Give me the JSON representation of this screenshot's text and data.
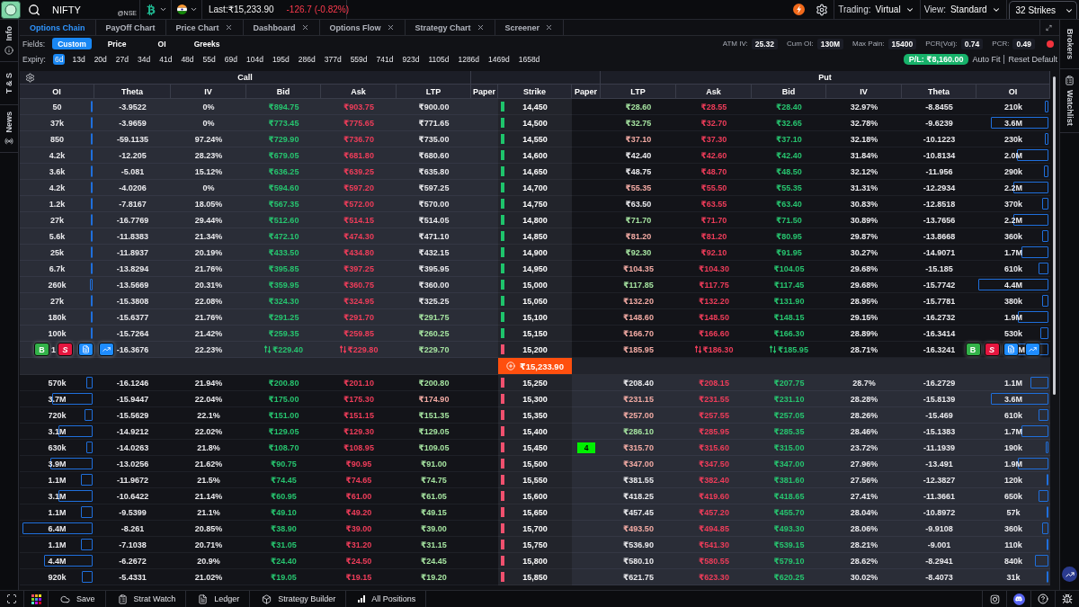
{
  "top_bar": {
    "symbol": "NIFTY",
    "exchange": "@NSE",
    "last": "Last:₹15,233.90",
    "change": "-126.7 (-0.82%)",
    "selectors": [
      {
        "label": "Trading:",
        "value": "Virtual"
      },
      {
        "label": "View:",
        "value": "Standard"
      }
    ],
    "strikes": "32 Strikes"
  },
  "left_sidebar": [
    {
      "label": "Info",
      "kind": "info"
    },
    {
      "label": "T & S",
      "kind": "text"
    },
    {
      "label": "News",
      "kind": "news"
    }
  ],
  "right_sidebar": [
    {
      "label": "Brokers",
      "kind": "text"
    },
    {
      "label": "Watchlist",
      "kind": "watchlist"
    }
  ],
  "tabs": [
    {
      "label": "Options Chain",
      "selected": true,
      "closable": false
    },
    {
      "label": "PayOff Chart",
      "selected": false,
      "closable": false
    },
    {
      "label": "Price Chart",
      "selected": false,
      "closable": true
    },
    {
      "label": "Dashboard",
      "selected": false,
      "closable": true
    },
    {
      "label": "Options Flow",
      "selected": false,
      "closable": true
    },
    {
      "label": "Strategy Chart",
      "selected": false,
      "closable": true
    },
    {
      "label": "Screener",
      "selected": false,
      "closable": true
    }
  ],
  "fields": {
    "label": "Fields:",
    "options": [
      {
        "label": "Custom",
        "selected": true
      },
      {
        "label": "Price",
        "selected": false
      },
      {
        "label": "OI",
        "selected": false
      },
      {
        "label": "Greeks",
        "selected": false
      }
    ]
  },
  "stats": [
    {
      "label": "ATM IV:",
      "value": "25.32"
    },
    {
      "label": "Cum OI:",
      "value": "130M"
    },
    {
      "label": "Max Pain:",
      "value": "15400"
    },
    {
      "label": "PCR(Vol):",
      "value": "0.74"
    },
    {
      "label": "PCR:",
      "value": "0.49"
    }
  ],
  "expiry": {
    "label": "Expiry:",
    "options": [
      {
        "label": "6d",
        "selected": true
      },
      {
        "label": "13d",
        "selected": false
      },
      {
        "label": "20d",
        "selected": false
      },
      {
        "label": "27d",
        "selected": false
      },
      {
        "label": "34d",
        "selected": false
      },
      {
        "label": "41d",
        "selected": false
      },
      {
        "label": "48d",
        "selected": false
      },
      {
        "label": "55d",
        "selected": false
      },
      {
        "label": "69d",
        "selected": false
      },
      {
        "label": "104d",
        "selected": false
      },
      {
        "label": "195d",
        "selected": false
      },
      {
        "label": "286d",
        "selected": false
      },
      {
        "label": "377d",
        "selected": false
      },
      {
        "label": "559d",
        "selected": false
      },
      {
        "label": "741d",
        "selected": false
      },
      {
        "label": "923d",
        "selected": false
      },
      {
        "label": "1105d",
        "selected": false
      },
      {
        "label": "1286d",
        "selected": false
      },
      {
        "label": "1469d",
        "selected": false
      },
      {
        "label": "1658d",
        "selected": false
      }
    ]
  },
  "pnl": "P/L: ₹8,160.00",
  "links": [
    "Auto Fit",
    "Reset Default"
  ],
  "table": {
    "groups": [
      "Call",
      "Put"
    ],
    "columns": [
      "OI",
      "Theta",
      "IV",
      "Bid",
      "Ask",
      "LTP",
      "Paper",
      "Strike",
      "Paper",
      "LTP",
      "Ask",
      "Bid",
      "IV",
      "Theta",
      "OI"
    ],
    "rows": [
      {
        "kind": "strike",
        "strike": "14,450",
        "color": "#1ec46b",
        "hovered": false,
        "call": {
          "itm": true,
          "oi": "50",
          "level": 0.02,
          "theta": "-3.9522",
          "iv": "0%",
          "bid": "₹894.75",
          "ask": "₹903.75",
          "ltp": "₹900.00",
          "up": false,
          "down": false
        },
        "put": {
          "itm": false,
          "ltp": "₹28.60",
          "up": true,
          "down": false,
          "ask": "₹28.55",
          "bid": "₹28.40",
          "iv": "32.97%",
          "theta": "-8.8455",
          "oi": "210k",
          "level": 0.05
        }
      },
      {
        "kind": "strike",
        "strike": "14,500",
        "color": "#1ec46b",
        "hovered": false,
        "call": {
          "itm": true,
          "oi": "37k",
          "level": 0.02,
          "theta": "-3.9659",
          "iv": "0%",
          "bid": "₹773.45",
          "ask": "₹775.65",
          "ltp": "₹771.65",
          "up": false,
          "down": false
        },
        "put": {
          "itm": false,
          "ltp": "₹32.75",
          "up": true,
          "down": false,
          "ask": "₹32.70",
          "bid": "₹32.65",
          "iv": "32.78%",
          "theta": "-9.6239",
          "oi": "3.6M",
          "level": 0.78
        }
      },
      {
        "kind": "strike",
        "strike": "14,550",
        "color": "#1ec46b",
        "hovered": false,
        "call": {
          "itm": true,
          "oi": "850",
          "level": 0.02,
          "theta": "-59.1135",
          "iv": "97.24%",
          "bid": "₹729.90",
          "ask": "₹736.70",
          "ltp": "₹735.00",
          "up": false,
          "down": false
        },
        "put": {
          "itm": false,
          "ltp": "₹37.10",
          "up": false,
          "down": true,
          "ask": "₹37.30",
          "bid": "₹37.10",
          "iv": "32.18%",
          "theta": "-10.1223",
          "oi": "230k",
          "level": 0.05
        }
      },
      {
        "kind": "strike",
        "strike": "14,600",
        "color": "#1ec46b",
        "hovered": false,
        "call": {
          "itm": true,
          "oi": "4.2k",
          "level": 0.02,
          "theta": "-12.205",
          "iv": "28.23%",
          "bid": "₹679.05",
          "ask": "₹681.80",
          "ltp": "₹680.60",
          "up": false,
          "down": false
        },
        "put": {
          "itm": false,
          "ltp": "₹42.40",
          "up": false,
          "down": false,
          "ask": "₹42.60",
          "bid": "₹42.40",
          "iv": "31.84%",
          "theta": "-10.8134",
          "oi": "2.0M",
          "level": 0.43
        }
      },
      {
        "kind": "strike",
        "strike": "14,650",
        "color": "#1ec46b",
        "hovered": false,
        "call": {
          "itm": true,
          "oi": "3.6k",
          "level": 0.02,
          "theta": "-5.081",
          "iv": "15.12%",
          "bid": "₹636.25",
          "ask": "₹639.25",
          "ltp": "₹635.80",
          "up": false,
          "down": false
        },
        "put": {
          "itm": false,
          "ltp": "₹48.75",
          "up": false,
          "down": false,
          "ask": "₹48.70",
          "bid": "₹48.50",
          "iv": "32.12%",
          "theta": "-11.956",
          "oi": "290k",
          "level": 0.06
        }
      },
      {
        "kind": "strike",
        "strike": "14,700",
        "color": "#1ec46b",
        "hovered": false,
        "call": {
          "itm": true,
          "oi": "4.2k",
          "level": 0.02,
          "theta": "-4.0206",
          "iv": "0%",
          "bid": "₹594.60",
          "ask": "₹597.20",
          "ltp": "₹597.25",
          "up": false,
          "down": false
        },
        "put": {
          "itm": false,
          "ltp": "₹55.35",
          "up": false,
          "down": true,
          "ask": "₹55.50",
          "bid": "₹55.35",
          "iv": "31.31%",
          "theta": "-12.2934",
          "oi": "2.2M",
          "level": 0.47
        }
      },
      {
        "kind": "strike",
        "strike": "14,750",
        "color": "#1ec46b",
        "hovered": false,
        "call": {
          "itm": true,
          "oi": "1.2k",
          "level": 0.02,
          "theta": "-7.8167",
          "iv": "18.05%",
          "bid": "₹567.35",
          "ask": "₹572.00",
          "ltp": "₹570.00",
          "up": false,
          "down": false
        },
        "put": {
          "itm": false,
          "ltp": "₹63.50",
          "up": false,
          "down": false,
          "ask": "₹63.55",
          "bid": "₹63.40",
          "iv": "30.83%",
          "theta": "-12.8518",
          "oi": "370k",
          "level": 0.08
        }
      },
      {
        "kind": "strike",
        "strike": "14,800",
        "color": "#1ec46b",
        "hovered": false,
        "call": {
          "itm": true,
          "oi": "27k",
          "level": 0.02,
          "theta": "-16.7769",
          "iv": "29.44%",
          "bid": "₹512.60",
          "ask": "₹514.15",
          "ltp": "₹514.05",
          "up": false,
          "down": false
        },
        "put": {
          "itm": false,
          "ltp": "₹71.70",
          "up": true,
          "down": false,
          "ask": "₹71.70",
          "bid": "₹71.50",
          "iv": "30.89%",
          "theta": "-13.7656",
          "oi": "2.2M",
          "level": 0.47
        }
      },
      {
        "kind": "strike",
        "strike": "14,850",
        "color": "#1ec46b",
        "hovered": false,
        "call": {
          "itm": true,
          "oi": "5.6k",
          "level": 0.02,
          "theta": "-11.8383",
          "iv": "21.34%",
          "bid": "₹472.10",
          "ask": "₹474.30",
          "ltp": "₹471.10",
          "up": false,
          "down": false
        },
        "put": {
          "itm": false,
          "ltp": "₹81.20",
          "up": false,
          "down": true,
          "ask": "₹81.20",
          "bid": "₹80.95",
          "iv": "29.87%",
          "theta": "-13.8668",
          "oi": "360k",
          "level": 0.08
        }
      },
      {
        "kind": "strike",
        "strike": "14,900",
        "color": "#1ec46b",
        "hovered": false,
        "call": {
          "itm": true,
          "oi": "25k",
          "level": 0.02,
          "theta": "-11.8937",
          "iv": "20.19%",
          "bid": "₹433.50",
          "ask": "₹434.80",
          "ltp": "₹432.15",
          "up": false,
          "down": false
        },
        "put": {
          "itm": false,
          "ltp": "₹92.30",
          "up": true,
          "down": false,
          "ask": "₹92.10",
          "bid": "₹91.95",
          "iv": "30.27%",
          "theta": "-14.9071",
          "oi": "1.7M",
          "level": 0.37
        }
      },
      {
        "kind": "strike",
        "strike": "14,950",
        "color": "#1ec46b",
        "hovered": false,
        "call": {
          "itm": true,
          "oi": "6.7k",
          "level": 0.02,
          "theta": "-13.8294",
          "iv": "21.76%",
          "bid": "₹395.85",
          "ask": "₹397.25",
          "ltp": "₹395.95",
          "up": false,
          "down": false
        },
        "put": {
          "itm": false,
          "ltp": "₹104.35",
          "up": false,
          "down": true,
          "ask": "₹104.30",
          "bid": "₹104.05",
          "iv": "29.68%",
          "theta": "-15.185",
          "oi": "610k",
          "level": 0.13
        }
      },
      {
        "kind": "strike",
        "strike": "15,000",
        "color": "#1ec46b",
        "hovered": false,
        "call": {
          "itm": true,
          "oi": "260k",
          "level": 0.04,
          "theta": "-13.5669",
          "iv": "20.31%",
          "bid": "₹359.95",
          "ask": "₹360.75",
          "ltp": "₹360.00",
          "up": false,
          "down": false
        },
        "put": {
          "itm": false,
          "ltp": "₹117.85",
          "up": true,
          "down": false,
          "ask": "₹117.75",
          "bid": "₹117.45",
          "iv": "29.68%",
          "theta": "-15.7742",
          "oi": "4.4M",
          "level": 0.95
        }
      },
      {
        "kind": "strike",
        "strike": "15,050",
        "color": "#1ec46b",
        "hovered": false,
        "call": {
          "itm": true,
          "oi": "27k",
          "level": 0.02,
          "theta": "-15.3808",
          "iv": "22.08%",
          "bid": "₹324.30",
          "ask": "₹324.95",
          "ltp": "₹325.25",
          "up": false,
          "down": false
        },
        "put": {
          "itm": false,
          "ltp": "₹132.20",
          "up": false,
          "down": true,
          "ask": "₹132.20",
          "bid": "₹131.90",
          "iv": "28.95%",
          "theta": "-15.7781",
          "oi": "380k",
          "level": 0.08
        }
      },
      {
        "kind": "strike",
        "strike": "15,100",
        "color": "#1ec46b",
        "hovered": false,
        "call": {
          "itm": true,
          "oi": "180k",
          "level": 0.03,
          "theta": "-15.6377",
          "iv": "21.76%",
          "bid": "₹291.25",
          "ask": "₹291.70",
          "ltp": "₹291.75",
          "up": true,
          "down": false
        },
        "put": {
          "itm": false,
          "ltp": "₹148.60",
          "up": false,
          "down": true,
          "ask": "₹148.50",
          "bid": "₹148.15",
          "iv": "29.15%",
          "theta": "-16.2732",
          "oi": "1.9M",
          "level": 0.41
        }
      },
      {
        "kind": "strike",
        "strike": "15,150",
        "color": "#1ec46b",
        "hovered": false,
        "call": {
          "itm": true,
          "oi": "100k",
          "level": 0.02,
          "theta": "-15.7264",
          "iv": "21.42%",
          "bid": "₹259.35",
          "ask": "₹259.85",
          "ltp": "₹260.25",
          "up": true,
          "down": false
        },
        "put": {
          "itm": false,
          "ltp": "₹166.70",
          "up": false,
          "down": true,
          "ask": "₹166.60",
          "bid": "₹166.30",
          "iv": "28.89%",
          "theta": "-16.3414",
          "oi": "530k",
          "level": 0.11
        }
      },
      {
        "kind": "strike",
        "strike": "15,200",
        "color": "#f0506e",
        "hovered": true,
        "call": {
          "itm": true,
          "oi": "1",
          "theta": "-16.3676",
          "iv": "22.23%",
          "bid": "₹229.40",
          "ask": "₹229.80",
          "ltp": "₹229.70",
          "up": true,
          "down": false,
          "actions": [
            {
              "label": "B",
              "kind": "buy"
            },
            {
              "label": "S",
              "kind": "sell"
            }
          ]
        },
        "put": {
          "itm": false,
          "ltp": "₹185.95",
          "up": false,
          "down": true,
          "ask": "₹186.30",
          "bid": "₹185.95",
          "iv": "28.71%",
          "theta": "-16.3241",
          "oi": "M",
          "level": 0.46,
          "actions": [
            {
              "label": "B",
              "kind": "buy"
            },
            {
              "label": "S",
              "kind": "sell"
            }
          ]
        }
      },
      {
        "kind": "spot",
        "price": "₹15,233.90"
      },
      {
        "kind": "strike",
        "strike": "15,250",
        "color": "#f0506e",
        "hovered": false,
        "call": {
          "itm": false,
          "oi": "570k",
          "level": 0.08,
          "theta": "-16.1246",
          "iv": "21.94%",
          "bid": "₹200.80",
          "ask": "₹201.10",
          "ltp": "₹200.80",
          "up": true,
          "down": false
        },
        "put": {
          "itm": true,
          "ltp": "₹208.40",
          "up": false,
          "down": false,
          "ask": "₹208.15",
          "bid": "₹207.75",
          "iv": "28.7%",
          "theta": "-16.2729",
          "oi": "1.1M",
          "level": 0.24
        }
      },
      {
        "kind": "strike",
        "strike": "15,300",
        "color": "#f0506e",
        "hovered": false,
        "call": {
          "itm": false,
          "oi": "3.7M",
          "level": 0.54,
          "theta": "-15.9447",
          "iv": "22.04%",
          "bid": "₹175.00",
          "ask": "₹175.30",
          "ltp": "₹174.90",
          "up": false,
          "down": true
        },
        "put": {
          "itm": true,
          "ltp": "₹231.15",
          "up": false,
          "down": true,
          "ask": "₹231.55",
          "bid": "₹231.10",
          "iv": "28.28%",
          "theta": "-15.8139",
          "oi": "3.6M",
          "level": 0.78
        }
      },
      {
        "kind": "strike",
        "strike": "15,350",
        "color": "#f0506e",
        "hovered": false,
        "call": {
          "itm": false,
          "oi": "720k",
          "level": 0.11,
          "theta": "-15.5629",
          "iv": "22.1%",
          "bid": "₹151.00",
          "ask": "₹151.15",
          "ltp": "₹151.35",
          "up": true,
          "down": false
        },
        "put": {
          "itm": true,
          "ltp": "₹257.00",
          "up": false,
          "down": true,
          "ask": "₹257.55",
          "bid": "₹257.05",
          "iv": "28.26%",
          "theta": "-15.469",
          "oi": "610k",
          "level": 0.13
        }
      },
      {
        "kind": "strike",
        "strike": "15,400",
        "color": "#f0506e",
        "hovered": false,
        "call": {
          "itm": false,
          "oi": "3.1M",
          "level": 0.46,
          "theta": "-14.9212",
          "iv": "22.02%",
          "bid": "₹129.05",
          "ask": "₹129.30",
          "ltp": "₹129.05",
          "up": true,
          "down": false
        },
        "put": {
          "itm": true,
          "ltp": "₹286.10",
          "up": true,
          "down": false,
          "ask": "₹285.95",
          "bid": "₹285.35",
          "iv": "28.46%",
          "theta": "-15.1383",
          "oi": "1.7M",
          "level": 0.37
        }
      },
      {
        "kind": "strike",
        "strike": "15,450",
        "color": "#f0506e",
        "hovered": false,
        "call": {
          "itm": false,
          "oi": "630k",
          "level": 0.09,
          "theta": "-14.0263",
          "iv": "21.8%",
          "bid": "₹108.70",
          "ask": "₹108.95",
          "ltp": "₹109.05",
          "up": true,
          "down": false
        },
        "put": {
          "itm": true,
          "paper": "4",
          "ltp": "₹315.70",
          "up": false,
          "down": true,
          "ask": "₹315.60",
          "bid": "₹315.00",
          "iv": "23.72%",
          "theta": "-11.1939",
          "oi": "190k",
          "level": 0.04
        }
      },
      {
        "kind": "strike",
        "strike": "15,500",
        "color": "#f0506e",
        "hovered": false,
        "call": {
          "itm": false,
          "oi": "3.9M",
          "level": 0.57,
          "theta": "-13.0256",
          "iv": "21.62%",
          "bid": "₹90.75",
          "ask": "₹90.95",
          "ltp": "₹91.00",
          "up": true,
          "down": false
        },
        "put": {
          "itm": true,
          "ltp": "₹347.00",
          "up": false,
          "down": true,
          "ask": "₹347.50",
          "bid": "₹347.00",
          "iv": "27.96%",
          "theta": "-13.491",
          "oi": "1.9M",
          "level": 0.41
        }
      },
      {
        "kind": "strike",
        "strike": "15,550",
        "color": "#f0506e",
        "hovered": false,
        "call": {
          "itm": false,
          "oi": "1.1M",
          "level": 0.16,
          "theta": "-11.9672",
          "iv": "21.5%",
          "bid": "₹74.45",
          "ask": "₹74.65",
          "ltp": "₹74.75",
          "up": true,
          "down": false
        },
        "put": {
          "itm": true,
          "ltp": "₹381.55",
          "up": false,
          "down": false,
          "ask": "₹382.40",
          "bid": "₹381.60",
          "iv": "27.56%",
          "theta": "-12.3827",
          "oi": "120k",
          "level": 0.03
        }
      },
      {
        "kind": "strike",
        "strike": "15,600",
        "color": "#f0506e",
        "hovered": false,
        "call": {
          "itm": false,
          "oi": "3.1M",
          "level": 0.46,
          "theta": "-10.6422",
          "iv": "21.14%",
          "bid": "₹60.95",
          "ask": "₹61.00",
          "ltp": "₹61.05",
          "up": true,
          "down": false
        },
        "put": {
          "itm": true,
          "ltp": "₹418.25",
          "up": false,
          "down": false,
          "ask": "₹419.60",
          "bid": "₹418.65",
          "iv": "27.41%",
          "theta": "-11.3661",
          "oi": "650k",
          "level": 0.14
        }
      },
      {
        "kind": "strike",
        "strike": "15,650",
        "color": "#f0506e",
        "hovered": false,
        "call": {
          "itm": false,
          "oi": "1.1M",
          "level": 0.16,
          "theta": "-9.5399",
          "iv": "21.1%",
          "bid": "₹49.10",
          "ask": "₹49.20",
          "ltp": "₹49.15",
          "up": true,
          "down": false
        },
        "put": {
          "itm": true,
          "ltp": "₹457.45",
          "up": false,
          "down": false,
          "ask": "₹457.20",
          "bid": "₹455.70",
          "iv": "28.04%",
          "theta": "-10.8972",
          "oi": "57k",
          "level": 0.02
        }
      },
      {
        "kind": "strike",
        "strike": "15,700",
        "color": "#f0506e",
        "hovered": false,
        "call": {
          "itm": false,
          "oi": "6.4M",
          "level": 0.94,
          "theta": "-8.261",
          "iv": "20.85%",
          "bid": "₹38.90",
          "ask": "₹39.00",
          "ltp": "₹39.00",
          "up": true,
          "down": false
        },
        "put": {
          "itm": true,
          "ltp": "₹493.50",
          "up": false,
          "down": true,
          "ask": "₹494.85",
          "bid": "₹493.30",
          "iv": "28.06%",
          "theta": "-9.9108",
          "oi": "360k",
          "level": 0.08
        }
      },
      {
        "kind": "strike",
        "strike": "15,750",
        "color": "#f0506e",
        "hovered": false,
        "call": {
          "itm": false,
          "oi": "1.1M",
          "level": 0.16,
          "theta": "-7.1038",
          "iv": "20.71%",
          "bid": "₹31.05",
          "ask": "₹31.20",
          "ltp": "₹31.15",
          "up": true,
          "down": false
        },
        "put": {
          "itm": true,
          "ltp": "₹536.90",
          "up": false,
          "down": false,
          "ask": "₹541.30",
          "bid": "₹539.15",
          "iv": "28.21%",
          "theta": "-9.001",
          "oi": "110k",
          "level": 0.02
        }
      },
      {
        "kind": "strike",
        "strike": "15,800",
        "color": "#f0506e",
        "hovered": false,
        "call": {
          "itm": false,
          "oi": "4.4M",
          "level": 0.65,
          "theta": "-6.2672",
          "iv": "20.9%",
          "bid": "₹24.40",
          "ask": "₹24.50",
          "ltp": "₹24.45",
          "up": true,
          "down": false
        },
        "put": {
          "itm": true,
          "ltp": "₹580.10",
          "up": false,
          "down": false,
          "ask": "₹580.55",
          "bid": "₹579.10",
          "iv": "28.62%",
          "theta": "-8.2941",
          "oi": "840k",
          "level": 0.18
        }
      },
      {
        "kind": "strike",
        "strike": "15,850",
        "color": "#f0506e",
        "hovered": false,
        "call": {
          "itm": false,
          "oi": "920k",
          "level": 0.14,
          "theta": "-5.4331",
          "iv": "21.02%",
          "bid": "₹19.05",
          "ask": "₹19.15",
          "ltp": "₹19.20",
          "up": true,
          "down": false
        },
        "put": {
          "itm": true,
          "ltp": "₹621.75",
          "up": false,
          "down": false,
          "ask": "₹623.30",
          "bid": "₹620.25",
          "iv": "30.02%",
          "theta": "-8.4073",
          "oi": "31k",
          "level": 0.02
        }
      }
    ]
  },
  "bottom_bar": {
    "actions": [
      {
        "label": "Save",
        "kind": "cloud"
      },
      {
        "label": "Strat Watch",
        "kind": "watch"
      },
      {
        "label": "Ledger",
        "kind": "ledger"
      },
      {
        "label": "Strategy Builder",
        "kind": "cube"
      },
      {
        "label": "All Positions",
        "kind": "positions"
      }
    ]
  }
}
